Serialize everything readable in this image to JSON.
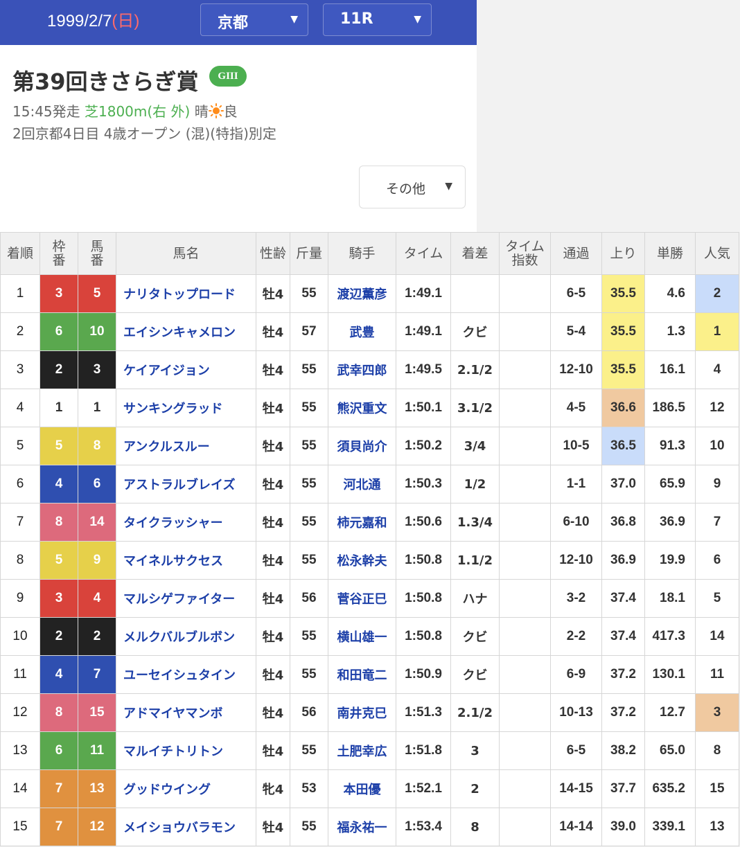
{
  "header": {
    "date": "1999/2/7",
    "day_of_week": "(日)",
    "venue": "京都",
    "race": "11R"
  },
  "race": {
    "title": "第39回きさらぎ賞",
    "grade": "GIII",
    "start": "15:45発走",
    "course": "芝1800m(右 外)",
    "weather": "晴",
    "weather_icon": "sun-icon",
    "going": "良",
    "conditions": "2回京都4日目  4歳オープン (混)(特指)別定",
    "other_label": "その他"
  },
  "columns": [
    "着順",
    "枠番",
    "馬番",
    "馬名",
    "性齢",
    "斤量",
    "騎手",
    "タイム",
    "着差",
    "タイム指数",
    "通過",
    "上り",
    "単勝",
    "人気"
  ],
  "column_lines": {
    "waku": [
      "枠",
      "番"
    ],
    "umaban": [
      "馬",
      "番"
    ],
    "time_index": [
      "タイム",
      "指数"
    ]
  },
  "colors": {
    "header_bg": "#3a52b8",
    "grade_bg": "#4caf50",
    "link": "#1c3fa8",
    "rank1": "#fbf08a",
    "rank2": "#c9dcfa",
    "rank3": "#f0c9a0"
  },
  "waku_colors": {
    "1": {
      "bg": "#ffffff",
      "fg": "#333333"
    },
    "2": {
      "bg": "#222222",
      "fg": "#ffffff"
    },
    "3": {
      "bg": "#d9433b",
      "fg": "#ffffff"
    },
    "4": {
      "bg": "#2f4fb0",
      "fg": "#ffffff"
    },
    "5": {
      "bg": "#e6d04a",
      "fg": "#ffffff"
    },
    "6": {
      "bg": "#5aa84e",
      "fg": "#ffffff"
    },
    "7": {
      "bg": "#e0913f",
      "fg": "#ffffff"
    },
    "8": {
      "bg": "#dd6a7c",
      "fg": "#ffffff"
    }
  },
  "rows": [
    {
      "rank": "1",
      "waku": "3",
      "umaban": "5",
      "horse": "ナリタトップロード",
      "sex_age": "牡4",
      "weight": "55",
      "jockey": "渡辺薫彦",
      "time": "1:49.1",
      "margin": "",
      "time_index": "",
      "pass": "6-5",
      "agari": "35.5",
      "agari_rank": 1,
      "odds": "4.6",
      "pop": "2",
      "pop_rank": 2
    },
    {
      "rank": "2",
      "waku": "6",
      "umaban": "10",
      "horse": "エイシンキャメロン",
      "sex_age": "牡4",
      "weight": "57",
      "jockey": "武豊",
      "time": "1:49.1",
      "margin": "クビ",
      "time_index": "",
      "pass": "5-4",
      "agari": "35.5",
      "agari_rank": 1,
      "odds": "1.3",
      "pop": "1",
      "pop_rank": 1
    },
    {
      "rank": "3",
      "waku": "2",
      "umaban": "3",
      "horse": "ケイアイジョン",
      "sex_age": "牡4",
      "weight": "55",
      "jockey": "武幸四郎",
      "time": "1:49.5",
      "margin": "2.1/2",
      "time_index": "",
      "pass": "12-10",
      "agari": "35.5",
      "agari_rank": 1,
      "odds": "16.1",
      "pop": "4",
      "pop_rank": 0
    },
    {
      "rank": "4",
      "waku": "1",
      "umaban": "1",
      "horse": "サンキングラッド",
      "sex_age": "牡4",
      "weight": "55",
      "jockey": "熊沢重文",
      "time": "1:50.1",
      "margin": "3.1/2",
      "time_index": "",
      "pass": "4-5",
      "agari": "36.6",
      "agari_rank": 3,
      "odds": "186.5",
      "pop": "12",
      "pop_rank": 0
    },
    {
      "rank": "5",
      "waku": "5",
      "umaban": "8",
      "horse": "アンクルスルー",
      "sex_age": "牡4",
      "weight": "55",
      "jockey": "須貝尚介",
      "time": "1:50.2",
      "margin": "3/4",
      "time_index": "",
      "pass": "10-5",
      "agari": "36.5",
      "agari_rank": 2,
      "odds": "91.3",
      "pop": "10",
      "pop_rank": 0
    },
    {
      "rank": "6",
      "waku": "4",
      "umaban": "6",
      "horse": "アストラルブレイズ",
      "sex_age": "牡4",
      "weight": "55",
      "jockey": "河北通",
      "time": "1:50.3",
      "margin": "1/2",
      "time_index": "",
      "pass": "1-1",
      "agari": "37.0",
      "agari_rank": 0,
      "odds": "65.9",
      "pop": "9",
      "pop_rank": 0
    },
    {
      "rank": "7",
      "waku": "8",
      "umaban": "14",
      "horse": "タイクラッシャー",
      "sex_age": "牡4",
      "weight": "55",
      "jockey": "柿元嘉和",
      "time": "1:50.6",
      "margin": "1.3/4",
      "time_index": "",
      "pass": "6-10",
      "agari": "36.8",
      "agari_rank": 0,
      "odds": "36.9",
      "pop": "7",
      "pop_rank": 0
    },
    {
      "rank": "8",
      "waku": "5",
      "umaban": "9",
      "horse": "マイネルサクセス",
      "sex_age": "牡4",
      "weight": "55",
      "jockey": "松永幹夫",
      "time": "1:50.8",
      "margin": "1.1/2",
      "time_index": "",
      "pass": "12-10",
      "agari": "36.9",
      "agari_rank": 0,
      "odds": "19.9",
      "pop": "6",
      "pop_rank": 0
    },
    {
      "rank": "9",
      "waku": "3",
      "umaban": "4",
      "horse": "マルシゲファイター",
      "sex_age": "牡4",
      "weight": "56",
      "jockey": "菅谷正巳",
      "time": "1:50.8",
      "margin": "ハナ",
      "time_index": "",
      "pass": "3-2",
      "agari": "37.4",
      "agari_rank": 0,
      "odds": "18.1",
      "pop": "5",
      "pop_rank": 0
    },
    {
      "rank": "10",
      "waku": "2",
      "umaban": "2",
      "horse": "メルクバルブルボン",
      "sex_age": "牡4",
      "weight": "55",
      "jockey": "横山雄一",
      "time": "1:50.8",
      "margin": "クビ",
      "time_index": "",
      "pass": "2-2",
      "agari": "37.4",
      "agari_rank": 0,
      "odds": "417.3",
      "pop": "14",
      "pop_rank": 0
    },
    {
      "rank": "11",
      "waku": "4",
      "umaban": "7",
      "horse": "ユーセイシュタイン",
      "sex_age": "牡4",
      "weight": "55",
      "jockey": "和田竜二",
      "time": "1:50.9",
      "margin": "クビ",
      "time_index": "",
      "pass": "6-9",
      "agari": "37.2",
      "agari_rank": 0,
      "odds": "130.1",
      "pop": "11",
      "pop_rank": 0
    },
    {
      "rank": "12",
      "waku": "8",
      "umaban": "15",
      "horse": "アドマイヤマンボ",
      "sex_age": "牡4",
      "weight": "56",
      "jockey": "南井克巳",
      "time": "1:51.3",
      "margin": "2.1/2",
      "time_index": "",
      "pass": "10-13",
      "agari": "37.2",
      "agari_rank": 0,
      "odds": "12.7",
      "pop": "3",
      "pop_rank": 3
    },
    {
      "rank": "13",
      "waku": "6",
      "umaban": "11",
      "horse": "マルイチトリトン",
      "sex_age": "牡4",
      "weight": "55",
      "jockey": "土肥幸広",
      "time": "1:51.8",
      "margin": "3",
      "time_index": "",
      "pass": "6-5",
      "agari": "38.2",
      "agari_rank": 0,
      "odds": "65.0",
      "pop": "8",
      "pop_rank": 0
    },
    {
      "rank": "14",
      "waku": "7",
      "umaban": "13",
      "horse": "グッドウイング",
      "sex_age": "牝4",
      "weight": "53",
      "jockey": "本田優",
      "time": "1:52.1",
      "margin": "2",
      "time_index": "",
      "pass": "14-15",
      "agari": "37.7",
      "agari_rank": 0,
      "odds": "635.2",
      "pop": "15",
      "pop_rank": 0
    },
    {
      "rank": "15",
      "waku": "7",
      "umaban": "12",
      "horse": "メイショウバラモン",
      "sex_age": "牡4",
      "weight": "55",
      "jockey": "福永祐一",
      "time": "1:53.4",
      "margin": "8",
      "time_index": "",
      "pass": "14-14",
      "agari": "39.0",
      "agari_rank": 0,
      "odds": "339.1",
      "pop": "13",
      "pop_rank": 0
    }
  ]
}
